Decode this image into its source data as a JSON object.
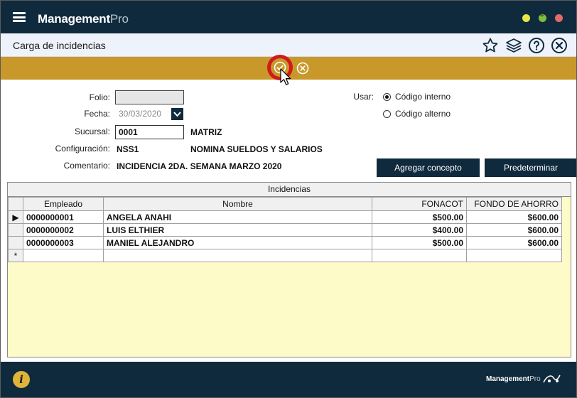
{
  "app": {
    "name_bold": "Management",
    "name_light": "Pro"
  },
  "page": {
    "title": "Carga de incidencias"
  },
  "form": {
    "folio_label": "Folio:",
    "folio_value": "",
    "fecha_label": "Fecha:",
    "fecha_value": "30/03/2020",
    "sucursal_label": "Sucursal:",
    "sucursal_value": "0001",
    "sucursal_name": "MATRIZ",
    "configuracion_label": "Configuración:",
    "configuracion_value": "NSS1",
    "configuracion_name": "NOMINA SUELDOS Y SALARIOS",
    "comentario_label": "Comentario:",
    "comentario_value": "INCIDENCIA 2DA. SEMANA MARZO 2020",
    "usar_label": "Usar:",
    "usar_options": [
      "Código interno",
      "Código alterno"
    ],
    "usar_selected": "Código interno"
  },
  "buttons": {
    "agregar_concepto": "Agregar concepto",
    "predeterminar": "Predeterminar"
  },
  "grid": {
    "caption": "Incidencias",
    "columns": [
      "Empleado",
      "Nombre",
      "FONACOT",
      "FONDO DE AHORRO"
    ],
    "rows": [
      {
        "marker": "▶",
        "empleado": "0000000001",
        "nombre": "ANGELA ANAHI",
        "fonacot": "$500.00",
        "fondo": "$600.00"
      },
      {
        "marker": "",
        "empleado": "0000000002",
        "nombre": "LUIS ELTHIER",
        "fonacot": "$400.00",
        "fondo": "$600.00"
      },
      {
        "marker": "",
        "empleado": "0000000003",
        "nombre": "MANIEL ALEJANDRO",
        "fonacot": "$500.00",
        "fondo": "$600.00"
      }
    ],
    "new_row_marker": "*"
  },
  "footer": {
    "brand_bold": "Management",
    "brand_light": "Pro",
    "info": "i"
  },
  "icons": [
    "menu-icon",
    "star-icon",
    "layers-icon",
    "help-icon",
    "close-icon",
    "check-icon",
    "cancel-icon",
    "calendar-dropdown-icon",
    "info-icon",
    "cursor-icon"
  ],
  "colors": {
    "header": "#0f2a3d",
    "toolbar": "#c9982b",
    "highlight": "#d11a1a",
    "grid_bg": "#fdfbc8"
  }
}
